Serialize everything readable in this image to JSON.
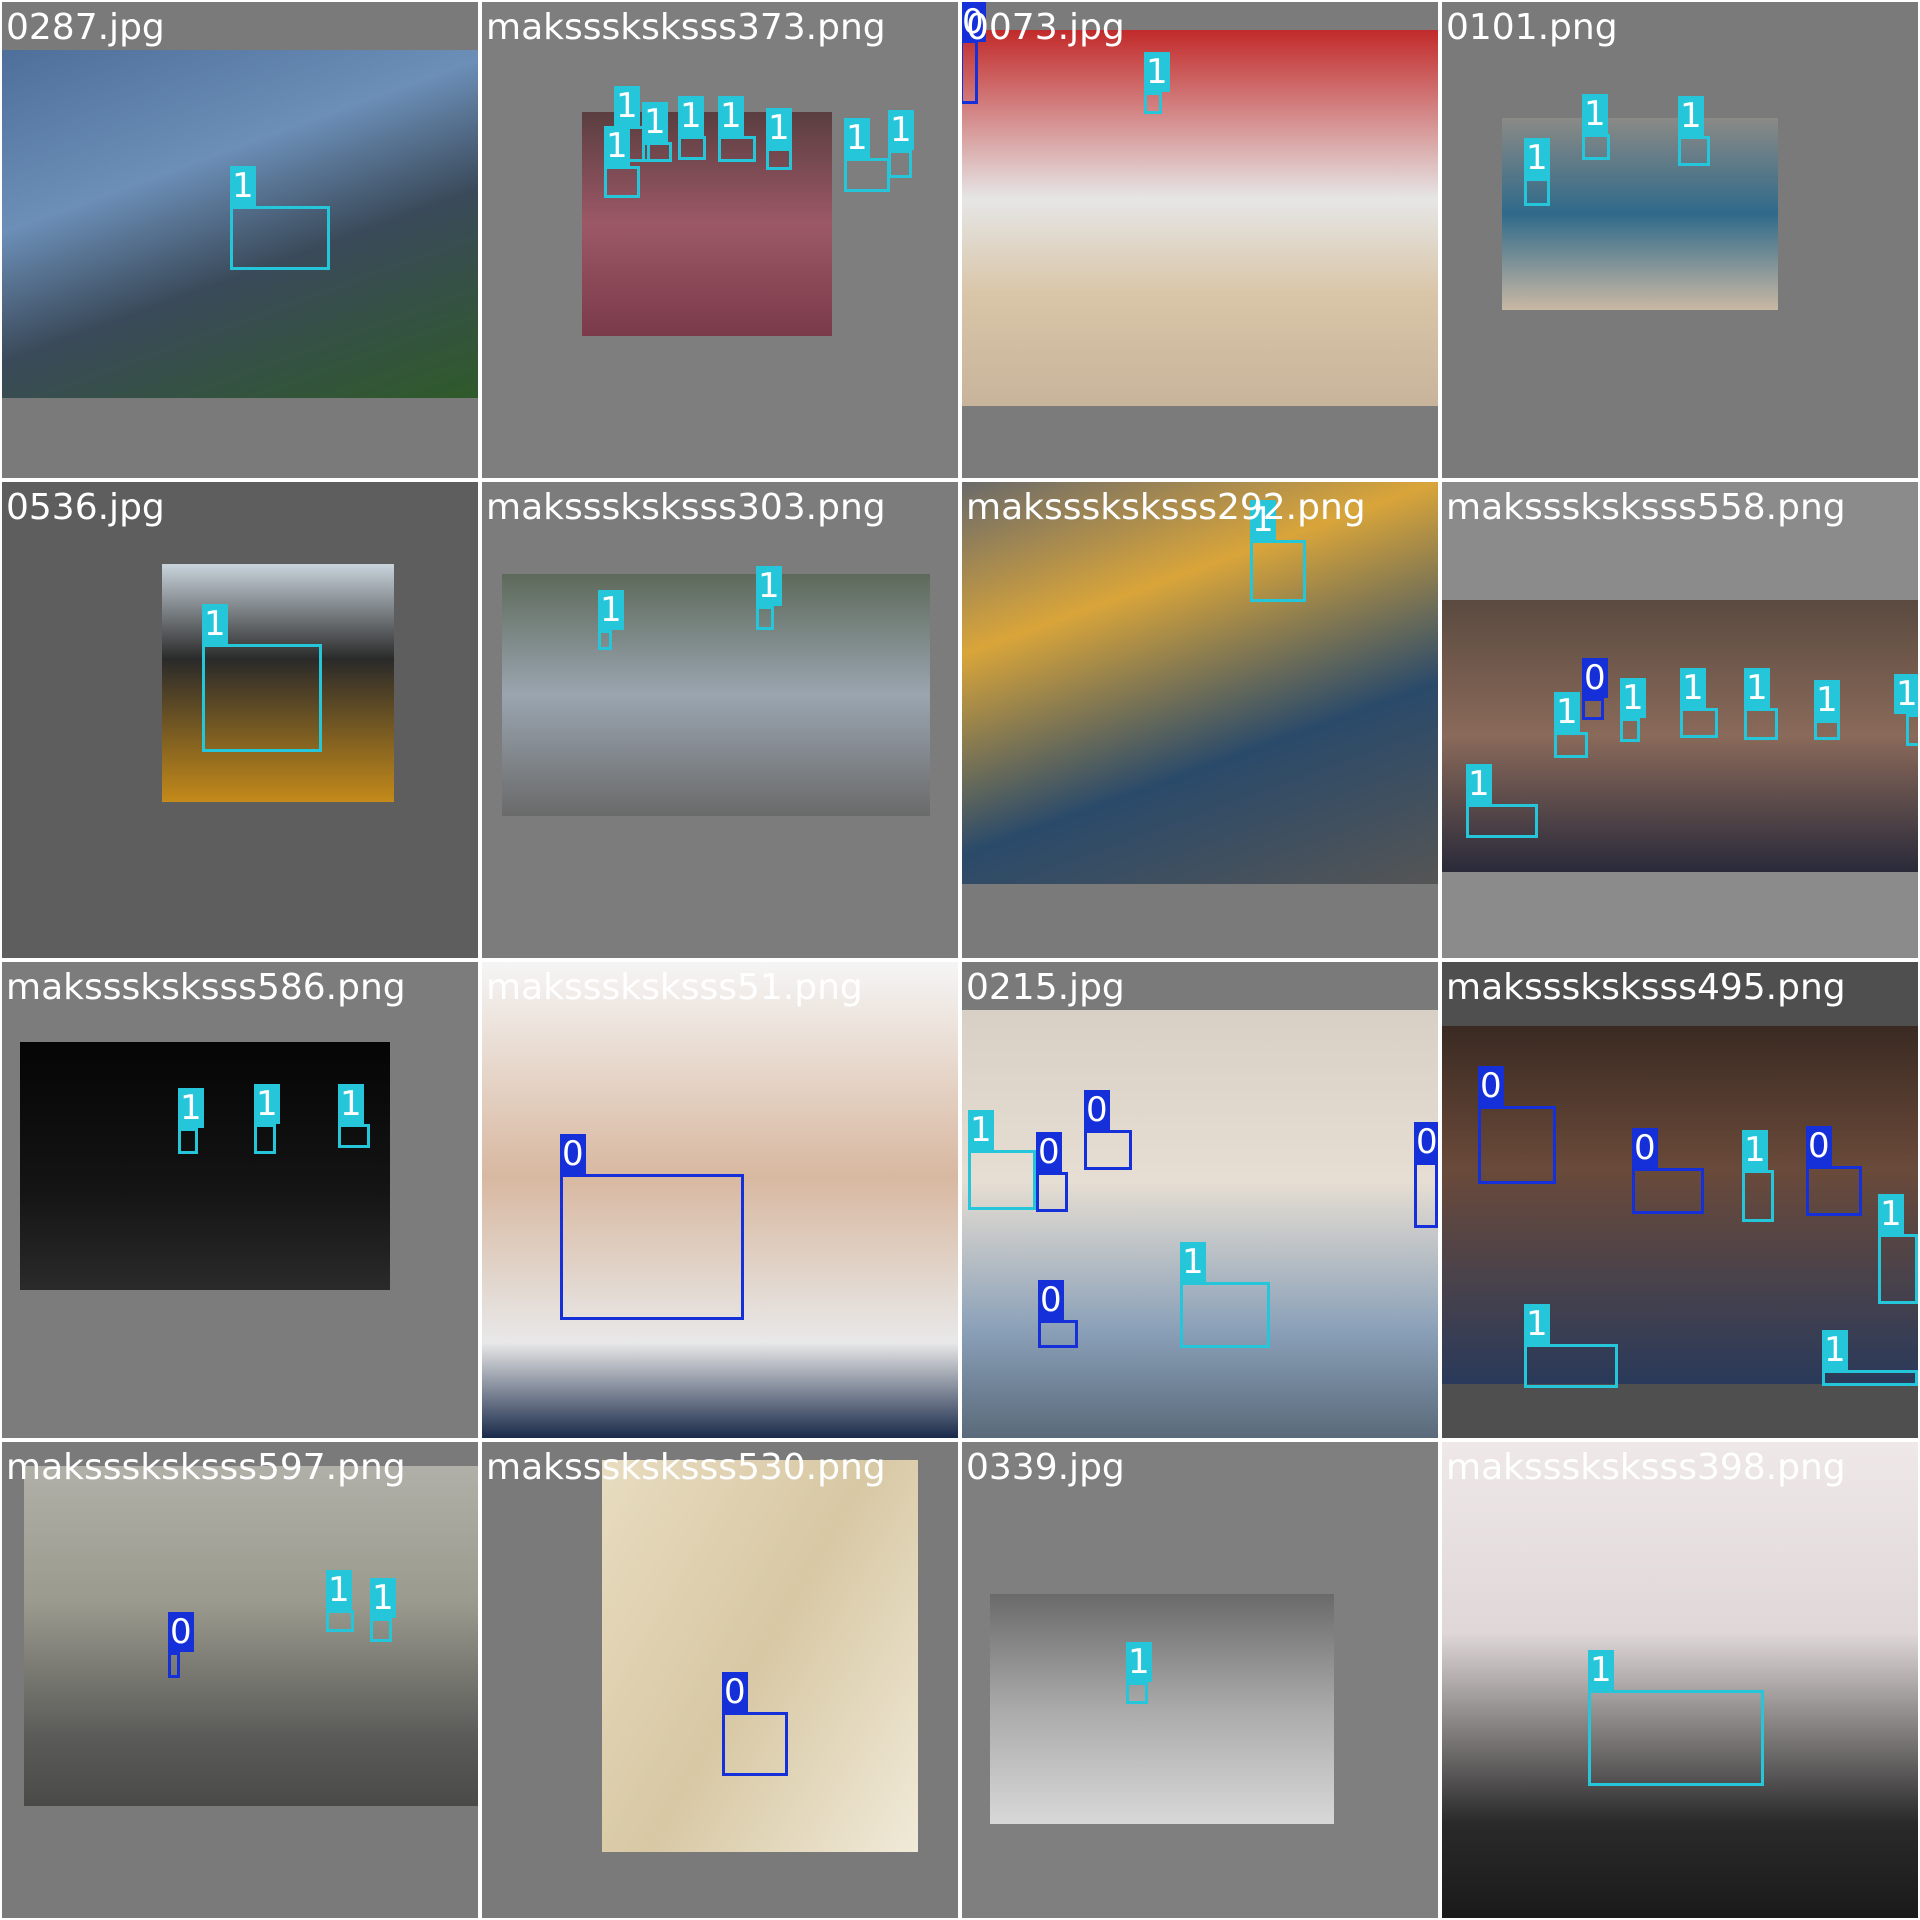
{
  "colors": {
    "class_0": "#1530d8",
    "class_1": "#26c6da"
  },
  "tiles": [
    {
      "filename": "0287.jpg",
      "bg": "#7a7a7a",
      "photo_bg": "linear-gradient(160deg,#4d6f9a 0%,#6c8fb8 35%,#3a4a5a 60%,#2f5a2a 100%)",
      "boxes": [
        {
          "label": "1"
        }
      ]
    },
    {
      "filename": "maksssksksss373.png",
      "bg": "#7e7e7e",
      "photo_bg": "linear-gradient(180deg,#5a3e40 0%,#9c5866 50%,#7a3a4a 100%)",
      "boxes": [
        {
          "label": "1"
        },
        {
          "label": "1"
        },
        {
          "label": "1"
        },
        {
          "label": "1"
        },
        {
          "label": "1"
        },
        {
          "label": "1"
        },
        {
          "label": "1"
        },
        {
          "label": "1"
        }
      ]
    },
    {
      "filename": "0073.jpg",
      "bg": "#7b7b7b",
      "photo_bg": "linear-gradient(180deg,#c22a2a 0%,#e6e6e6 45%,#d9c6a8 70%,#c7b49a 100%)",
      "boxes": [
        {
          "label": "0"
        },
        {
          "label": "1"
        }
      ]
    },
    {
      "filename": "0101.png",
      "bg": "#7a7a7a",
      "photo_bg": "linear-gradient(180deg,#8a8a86 0%,#2f6a8a 50%,#c9b8a4 100%)",
      "boxes": [
        {
          "label": "1"
        },
        {
          "label": "1"
        },
        {
          "label": "1"
        }
      ]
    },
    {
      "filename": "0536.jpg",
      "bg": "#5e5e5e",
      "photo_bg": "linear-gradient(180deg,#c9d4dc 0%,#2a2a2a 40%,#c48a1a 100%)",
      "boxes": [
        {
          "label": "1"
        }
      ]
    },
    {
      "filename": "maksssksksss303.png",
      "bg": "#7c7c7c",
      "photo_bg": "linear-gradient(180deg,#5d6a5a 0%,#9aa5b0 50%,#6a6a6a 100%)",
      "boxes": [
        {
          "label": "1"
        },
        {
          "label": "1"
        }
      ]
    },
    {
      "filename": "maksssksksss292.png",
      "bg": "#7a7a7a",
      "photo_bg": "linear-gradient(160deg,#6a6a6a 0%,#d9a53a 30%,#2a4a6a 65%,#555555 100%)",
      "boxes": [
        {
          "label": "1"
        }
      ]
    },
    {
      "filename": "maksssksksss558.png",
      "bg": "#8b8b8b",
      "photo_bg": "linear-gradient(180deg,#5a4a40 0%,#8a6a5a 50%,#2a2a3a 100%)",
      "boxes": [
        {
          "label": "0"
        },
        {
          "label": "1"
        },
        {
          "label": "1"
        },
        {
          "label": "1"
        },
        {
          "label": "1"
        },
        {
          "label": "1"
        },
        {
          "label": "1"
        },
        {
          "label": "1"
        }
      ]
    },
    {
      "filename": "maksssksksss586.png",
      "bg": "#7c7c7c",
      "photo_bg": "linear-gradient(180deg,#050505 0%,#141414 60%,#2a2a2a 100%)",
      "boxes": [
        {
          "label": "1"
        },
        {
          "label": "1"
        },
        {
          "label": "1"
        }
      ]
    },
    {
      "filename": "maksssksksss51.png",
      "bg": "#f3f3f3",
      "photo_bg": "linear-gradient(180deg,#f5f5f5 0%,#d8b8a0 45%,#e8e8e8 80%,#1a2a4a 100%)",
      "boxes": [
        {
          "label": "0"
        }
      ]
    },
    {
      "filename": "0215.jpg",
      "bg": "#7a7a7a",
      "photo_bg": "linear-gradient(180deg,#d8d0c4 0%,#e6ded2 40%,#8aa0b8 75%,#5a6a7a 100%)",
      "boxes": [
        {
          "label": "1"
        },
        {
          "label": "0"
        },
        {
          "label": "0"
        },
        {
          "label": "0"
        },
        {
          "label": "0"
        },
        {
          "label": "1"
        }
      ]
    },
    {
      "filename": "maksssksksss495.png",
      "bg": "#4f4f4f",
      "photo_bg": "linear-gradient(180deg,#3a2a22 0%,#6a4a3a 40%,#2a3a5a 100%)",
      "boxes": [
        {
          "label": "0"
        },
        {
          "label": "0"
        },
        {
          "label": "1"
        },
        {
          "label": "0"
        },
        {
          "label": "1"
        },
        {
          "label": "1"
        },
        {
          "label": "1"
        }
      ]
    },
    {
      "filename": "maksssksksss597.png",
      "bg": "#7a7a7a",
      "photo_bg": "linear-gradient(180deg,#b0b0a8 0%,#9a9a8e 40%,#5a5a58 80%,#4a4a48 100%)",
      "boxes": [
        {
          "label": "0"
        },
        {
          "label": "1"
        },
        {
          "label": "1"
        }
      ]
    },
    {
      "filename": "maksssksksss530.png",
      "bg": "#7a7a7a",
      "photo_bg": "linear-gradient(120deg,#e8dcc0 0%,#d8c8a4 50%,#f0ead8 100%)",
      "boxes": [
        {
          "label": "0"
        }
      ]
    },
    {
      "filename": "0339.jpg",
      "bg": "#7f7f7f",
      "photo_bg": "linear-gradient(180deg,#6a6a6a 0%,#aaaaaa 50%,#d8d8d8 100%)",
      "boxes": [
        {
          "label": "1"
        }
      ]
    },
    {
      "filename": "maksssksksss398.png",
      "bg": "#e9e3e3",
      "photo_bg": "linear-gradient(180deg,#efe8e8 0%,#e0d8d8 40%,#2a2a2a 80%,#1a1a1a 100%)",
      "boxes": [
        {
          "label": "1"
        }
      ]
    }
  ]
}
